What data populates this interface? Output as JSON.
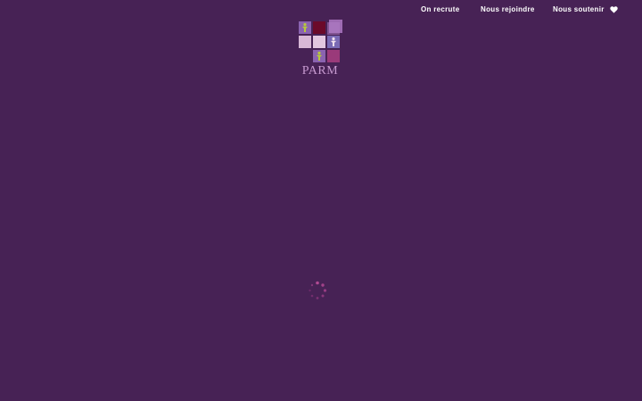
{
  "nav": {
    "recrute_label": "On recrute",
    "rejoindre_label": "Nous rejoindre",
    "soutenir_label": "Nous soutenir",
    "soutenir_icon": "heart-icon"
  },
  "logo": {
    "text": "PARM"
  },
  "loading": {
    "icon": "loading-spinner-icon"
  },
  "colors": {
    "background": "#472255",
    "accent_pink": "#a64a8c",
    "logo_text": "#c79ad0"
  }
}
